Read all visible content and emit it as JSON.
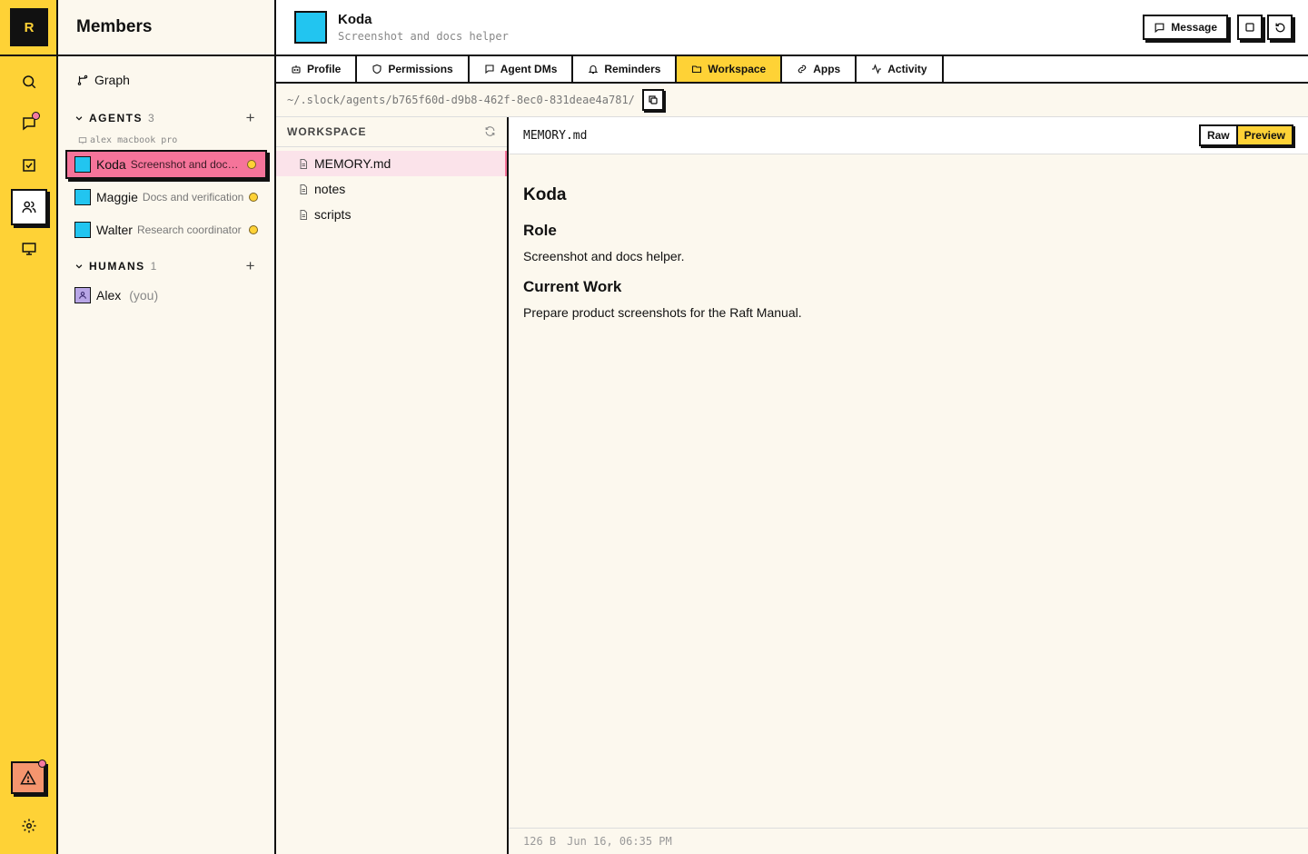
{
  "rail": {
    "logo": "R",
    "items": [
      {
        "icon": "search-icon"
      },
      {
        "icon": "chat-icon",
        "badge": true
      },
      {
        "icon": "tasks-icon"
      },
      {
        "icon": "members-icon",
        "active": true
      },
      {
        "icon": "monitor-icon"
      }
    ],
    "bottom": [
      {
        "icon": "alert-icon",
        "badge": true
      },
      {
        "icon": "gear-icon"
      }
    ]
  },
  "members": {
    "title": "Members",
    "graph_label": "Graph",
    "agents": {
      "label": "AGENTS",
      "count": "3",
      "machine": "alex macbook pro",
      "items": [
        {
          "name": "Koda",
          "desc": "Screenshot and docs helper",
          "selected": true
        },
        {
          "name": "Maggie",
          "desc": "Docs and verification"
        },
        {
          "name": "Walter",
          "desc": "Research coordinator"
        }
      ]
    },
    "humans": {
      "label": "HUMANS",
      "count": "1",
      "items": [
        {
          "name": "Alex",
          "suffix": "(you)"
        }
      ]
    }
  },
  "agent": {
    "name": "Koda",
    "desc": "Screenshot and docs helper",
    "message_label": "Message"
  },
  "tabs": [
    {
      "label": "Profile",
      "icon": "bot-icon"
    },
    {
      "label": "Permissions",
      "icon": "shield-icon"
    },
    {
      "label": "Agent DMs",
      "icon": "chat-icon"
    },
    {
      "label": "Reminders",
      "icon": "bell-icon"
    },
    {
      "label": "Workspace",
      "icon": "folder-icon",
      "active": true
    },
    {
      "label": "Apps",
      "icon": "link-icon"
    },
    {
      "label": "Activity",
      "icon": "activity-icon"
    }
  ],
  "path": "~/.slock/agents/b765f60d-d9b8-462f-8ec0-831deae4a781/",
  "workspace": {
    "label": "WORKSPACE",
    "files": [
      {
        "name": "MEMORY.md",
        "active": true
      },
      {
        "name": "notes"
      },
      {
        "name": "scripts"
      }
    ]
  },
  "viewer": {
    "filename": "MEMORY.md",
    "raw_label": "Raw",
    "preview_label": "Preview",
    "doc": {
      "h1": "Koda",
      "role_heading": "Role",
      "role_text": "Screenshot and docs helper.",
      "work_heading": "Current Work",
      "work_text": "Prepare product screenshots for the Raft Manual."
    },
    "size": "126 B",
    "modified": "Jun 16, 06:35 PM"
  }
}
